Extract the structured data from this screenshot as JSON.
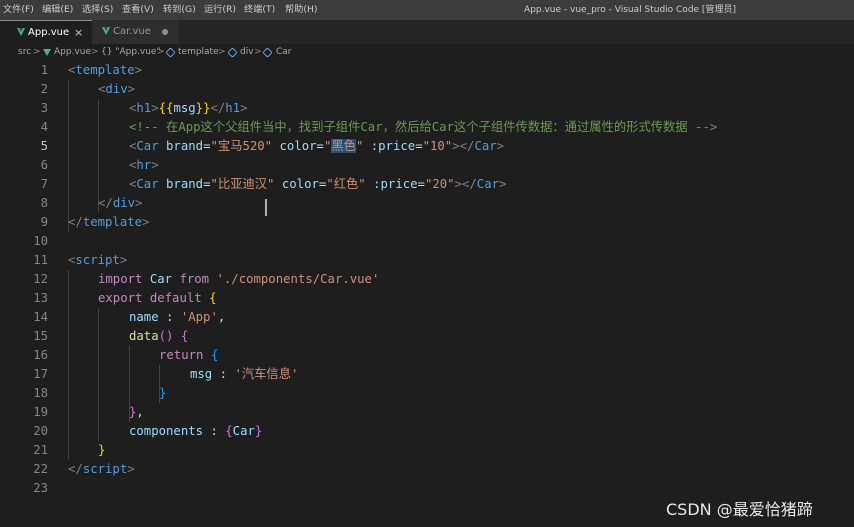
{
  "menu": [
    "文件(F)",
    "编辑(E)",
    "选择(S)",
    "查看(V)",
    "转到(G)",
    "运行(R)",
    "终端(T)",
    "帮助(H)"
  ],
  "window_title": "App.vue - vue_pro - Visual Studio Code [管理员]",
  "tabs": [
    {
      "label": "App.vue",
      "active": true,
      "close_glyph": "×"
    },
    {
      "label": "Car.vue",
      "active": false,
      "dirty": true
    }
  ],
  "breadcrumb": {
    "folder": "src",
    "file": "App.vue",
    "script_block": "{} \"App.vue\"",
    "template": "template",
    "div": "div",
    "car": "Car",
    "separator": ">"
  },
  "editor": {
    "active_line": 5,
    "line_numbers": [
      "1",
      "2",
      "3",
      "4",
      "5",
      "6",
      "7",
      "8",
      "9",
      "10",
      "11",
      "12",
      "13",
      "14",
      "15",
      "16",
      "17",
      "18",
      "19",
      "20",
      "21",
      "22",
      "23"
    ],
    "lines": [
      [
        "<",
        "template",
        ">"
      ],
      [
        "<",
        "div",
        ">"
      ],
      [
        "<",
        "h1",
        ">",
        "{{",
        "msg",
        "}}",
        "</",
        "h1",
        ">"
      ],
      [
        "<!-- 在App这个父组件当中，找到子组件Car，然后给Car这个子组件传数据：通过属性的形式传数据 -->"
      ],
      [
        "<",
        "Car",
        " ",
        "brand",
        "=",
        "\"宝马520\"",
        " ",
        "color",
        "=",
        "\"",
        "黑色",
        "\"",
        " ",
        ":price",
        "=",
        "\"10\"",
        "></",
        "Car",
        ">"
      ],
      [
        "<",
        "hr",
        ">"
      ],
      [
        "<",
        "Car",
        " ",
        "brand",
        "=",
        "\"比亚迪汉\"",
        " ",
        "color",
        "=",
        "\"红色\"",
        " ",
        ":price",
        "=",
        "\"20\"",
        "></",
        "Car",
        ">"
      ],
      [
        "</",
        "div",
        ">"
      ],
      [
        "</",
        "template",
        ">"
      ],
      [],
      [
        "<",
        "script",
        ">"
      ],
      [
        "import",
        " Car ",
        "from",
        " ",
        "'./components/Car.vue'"
      ],
      [
        "export",
        " ",
        "default",
        " ",
        "{"
      ],
      [
        "name",
        " : ",
        "'App'",
        ","
      ],
      [
        "data",
        "() ",
        "{"
      ],
      [
        "return",
        " ",
        "{"
      ],
      [
        "msg",
        " : ",
        "'汽车信息'"
      ],
      [
        "}"
      ],
      [
        "}",
        ","
      ],
      [
        "components",
        " : ",
        "{",
        "Car",
        "}"
      ],
      [
        "}"
      ],
      [
        "</",
        "script",
        ">"
      ],
      []
    ]
  },
  "icons": {
    "vue_file": "vue-file-icon",
    "tab_close": "close-icon",
    "unsaved": "unsaved-dot-icon",
    "component": "symbol-component-icon"
  },
  "colors": {
    "vue_green": "#41b883",
    "tag": "#569cd6",
    "attr": "#9cdcfe",
    "string": "#ce9178",
    "comment": "#6a9955",
    "keyword": "#c586c0"
  },
  "watermark": "CSDN @最爱恰猪蹄"
}
